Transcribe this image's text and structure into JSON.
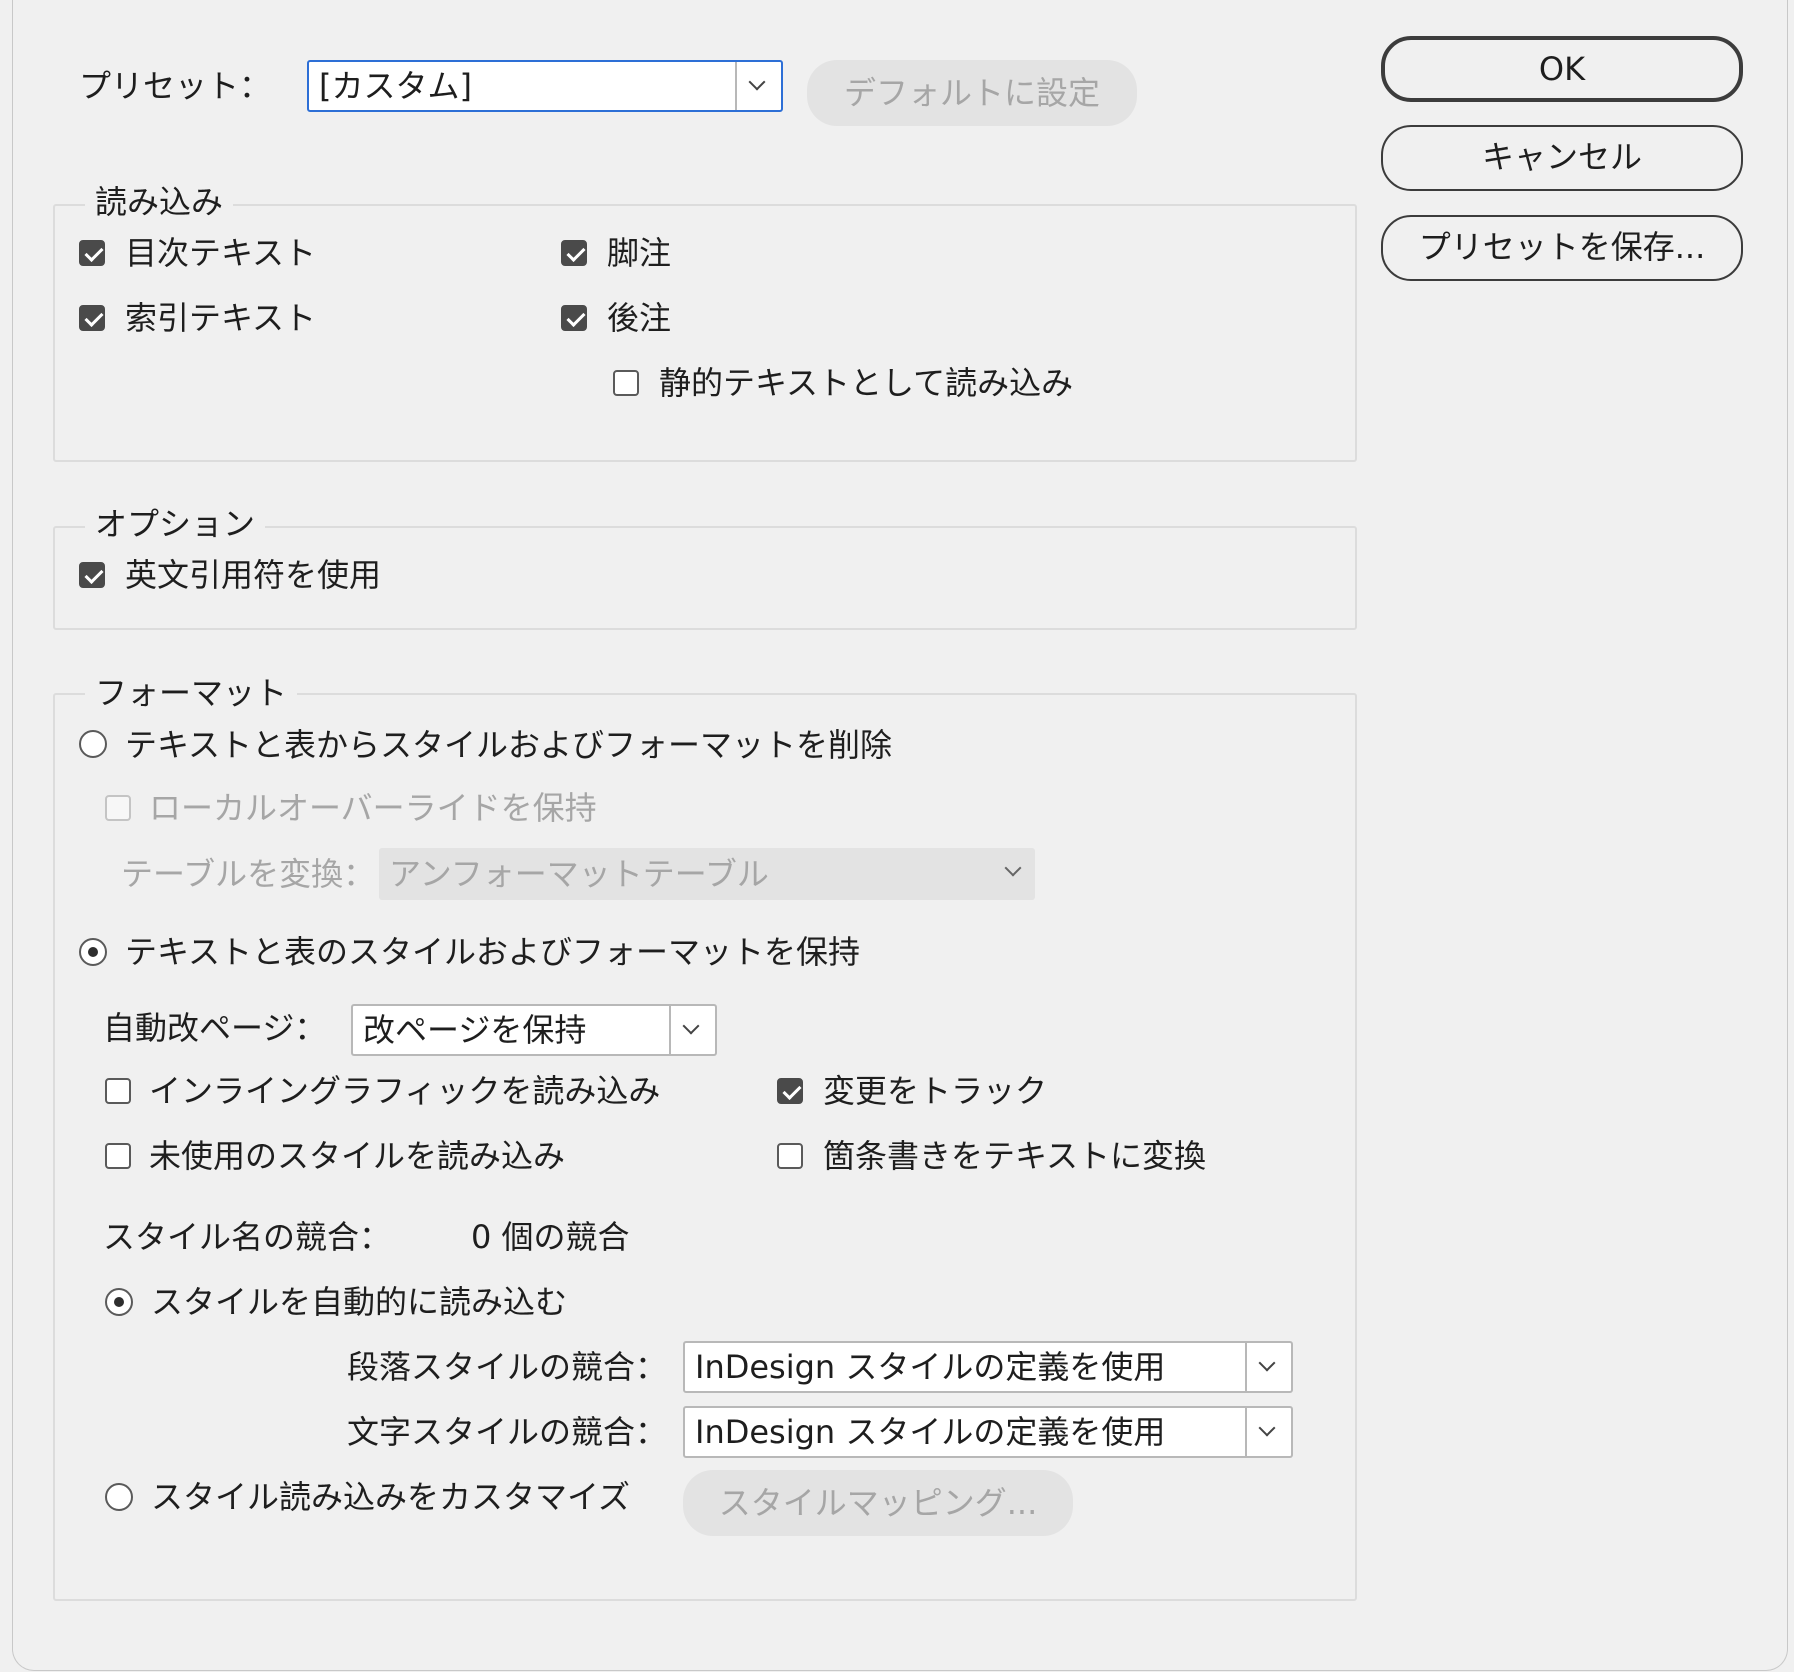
{
  "preset": {
    "label": "プリセット：",
    "value": "[カスタム]",
    "default_button": "デフォルトに設定"
  },
  "buttons": {
    "ok": "OK",
    "cancel": "キャンセル",
    "save_preset": "プリセットを保存..."
  },
  "import_group": {
    "title": "読み込み",
    "toc_text": {
      "label": "目次テキスト",
      "checked": true
    },
    "index_text": {
      "label": "索引テキスト",
      "checked": true
    },
    "footnotes": {
      "label": "脚注",
      "checked": true
    },
    "endnotes": {
      "label": "後注",
      "checked": true
    },
    "static_text": {
      "label": "静的テキストとして読み込み",
      "checked": false
    }
  },
  "options_group": {
    "title": "オプション",
    "typographer_quotes": {
      "label": "英文引用符を使用",
      "checked": true
    }
  },
  "format_group": {
    "title": "フォーマット",
    "remove_styles": {
      "label": "テキストと表からスタイルおよびフォーマットを削除",
      "selected": false
    },
    "preserve_local_overrides": {
      "label": "ローカルオーバーライドを保持",
      "checked": false,
      "disabled": true
    },
    "convert_table": {
      "label": "テーブルを変換：",
      "value": "アンフォーマットテーブル"
    },
    "preserve_styles": {
      "label": "テキストと表のスタイルおよびフォーマットを保持",
      "selected": true
    },
    "page_break": {
      "label": "自動改ページ：",
      "value": "改ページを保持"
    },
    "inline_graphics": {
      "label": "インライングラフィックを読み込み",
      "checked": false
    },
    "track_changes": {
      "label": "変更をトラック",
      "checked": true
    },
    "unused_styles": {
      "label": "未使用のスタイルを読み込み",
      "checked": false
    },
    "bullets_to_text": {
      "label": "箇条書きをテキストに変換",
      "checked": false
    },
    "style_conflicts": {
      "label": "スタイル名の競合：",
      "value": "0 個の競合"
    },
    "auto_import": {
      "label": "スタイルを自動的に読み込む",
      "selected": true
    },
    "para_conflict": {
      "label": "段落スタイルの競合：",
      "value": "InDesign スタイルの定義を使用"
    },
    "char_conflict": {
      "label": "文字スタイルの競合：",
      "value": "InDesign スタイルの定義を使用"
    },
    "customize": {
      "label": "スタイル読み込みをカスタマイズ",
      "selected": false
    },
    "style_mapping_button": "スタイルマッピング..."
  }
}
